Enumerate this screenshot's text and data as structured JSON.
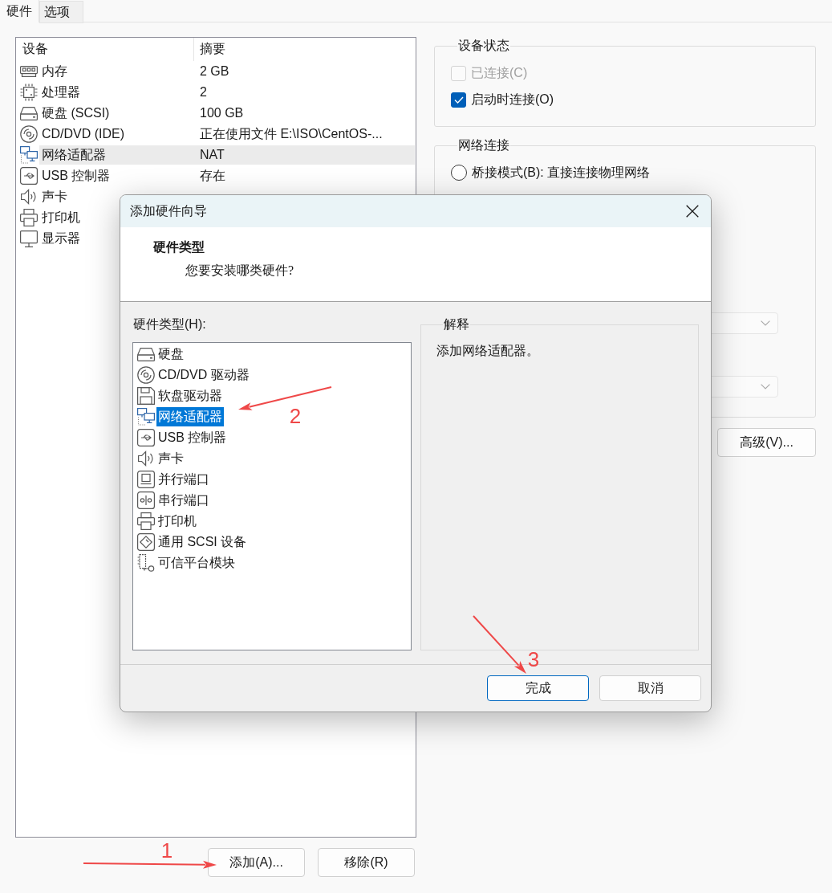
{
  "tabs": [
    {
      "label": "硬件",
      "selected": true
    },
    {
      "label": "选项",
      "selected": false
    }
  ],
  "device_list": {
    "columns": [
      "设备",
      "摘要"
    ],
    "rows": [
      {
        "kind": "memory",
        "device": "内存",
        "summary": "2 GB",
        "selected": false
      },
      {
        "kind": "cpu",
        "device": "处理器",
        "summary": "2",
        "selected": false
      },
      {
        "kind": "disk",
        "device": "硬盘 (SCSI)",
        "summary": "100 GB",
        "selected": false
      },
      {
        "kind": "cdrom",
        "device": "CD/DVD (IDE)",
        "summary": "正在使用文件 E:\\ISO\\CentOS-...",
        "selected": false
      },
      {
        "kind": "network",
        "device": "网络适配器",
        "summary": "NAT",
        "selected": true
      },
      {
        "kind": "usb",
        "device": "USB 控制器",
        "summary": "存在",
        "selected": false
      },
      {
        "kind": "sound",
        "device": "声卡",
        "selected": false
      },
      {
        "kind": "printer",
        "device": "打印机",
        "selected": false
      },
      {
        "kind": "display",
        "device": "显示器",
        "selected": false
      }
    ]
  },
  "device_buttons": [
    "添加(A)...",
    "移除(R)"
  ],
  "device_status": {
    "title": "设备状态",
    "options": [
      {
        "label": "已连接(C)",
        "checked": false,
        "disabled": true
      },
      {
        "label": "启动时连接(O)",
        "checked": true,
        "disabled": false
      }
    ]
  },
  "network_connection": {
    "title": "网络连接",
    "options": [
      {
        "label": "桥接模式(B): 直接连接物理网络",
        "selected": false
      }
    ],
    "dropdowns": [
      {
        "disabled": true
      },
      {
        "disabled": true
      }
    ]
  },
  "advanced_button": "高级(V)...",
  "dialog": {
    "title": "添加硬件向导",
    "heading": "硬件类型",
    "subheading": "您要安装哪类硬件?",
    "list_label": "硬件类型(H):",
    "hardware_types": [
      {
        "kind": "disk",
        "label": "硬盘",
        "selected": false
      },
      {
        "kind": "cdrom",
        "label": "CD/DVD 驱动器",
        "selected": false
      },
      {
        "kind": "floppy",
        "label": "软盘驱动器",
        "selected": false
      },
      {
        "kind": "network",
        "label": "网络适配器",
        "selected": true
      },
      {
        "kind": "usb",
        "label": "USB 控制器",
        "selected": false
      },
      {
        "kind": "sound",
        "label": "声卡",
        "selected": false
      },
      {
        "kind": "parallel",
        "label": "并行端口",
        "selected": false
      },
      {
        "kind": "serial",
        "label": "串行端口",
        "selected": false
      },
      {
        "kind": "printer",
        "label": "打印机",
        "selected": false
      },
      {
        "kind": "scsi",
        "label": "通用 SCSI 设备",
        "selected": false
      },
      {
        "kind": "tpm",
        "label": "可信平台模块",
        "selected": false
      }
    ],
    "explanation": {
      "title": "解释",
      "text": "添加网络适配器。"
    },
    "buttons": [
      {
        "label": "完成",
        "default": true
      },
      {
        "label": "取消",
        "default": false
      }
    ]
  },
  "annotations": [
    {
      "label": "1"
    },
    {
      "label": "2"
    },
    {
      "label": "3"
    }
  ]
}
